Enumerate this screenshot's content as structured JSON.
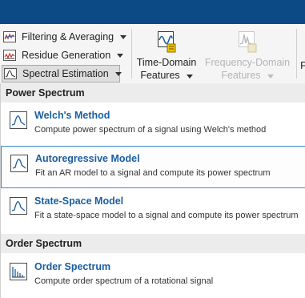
{
  "ribbon": {
    "items": [
      {
        "label": "Filtering & Averaging",
        "icon": "filtering-icon"
      },
      {
        "label": "Residue Generation",
        "icon": "residue-icon"
      },
      {
        "label": "Spectral Estimation",
        "icon": "spectral-estimation-icon"
      }
    ],
    "time_domain": {
      "line1": "Time-Domain",
      "line2": "Features"
    },
    "frequency_domain": {
      "line1": "Frequency-Domain",
      "line2": "Features"
    },
    "truncated_label": "F"
  },
  "menu": {
    "sections": [
      {
        "header": "Power Spectrum",
        "items": [
          {
            "title": "Welch's Method",
            "desc": "Compute power spectrum of a signal using Welch's method",
            "icon": "power-spectrum-icon"
          },
          {
            "title": "Autoregressive Model",
            "desc": "Fit an AR model to a signal and compute its power spectrum",
            "icon": "power-spectrum-icon"
          },
          {
            "title": "State-Space Model",
            "desc": "Fit a state-space model to a signal and compute its power spectrum",
            "icon": "power-spectrum-icon"
          }
        ]
      },
      {
        "header": "Order Spectrum",
        "items": [
          {
            "title": "Order Spectrum",
            "desc": "Compute order spectrum of a rotational signal",
            "icon": "order-spectrum-icon"
          }
        ]
      }
    ]
  },
  "colors": {
    "titlebar": "#0c4a86",
    "link": "#1b5fa1",
    "hover_border": "#3a8bc8"
  }
}
